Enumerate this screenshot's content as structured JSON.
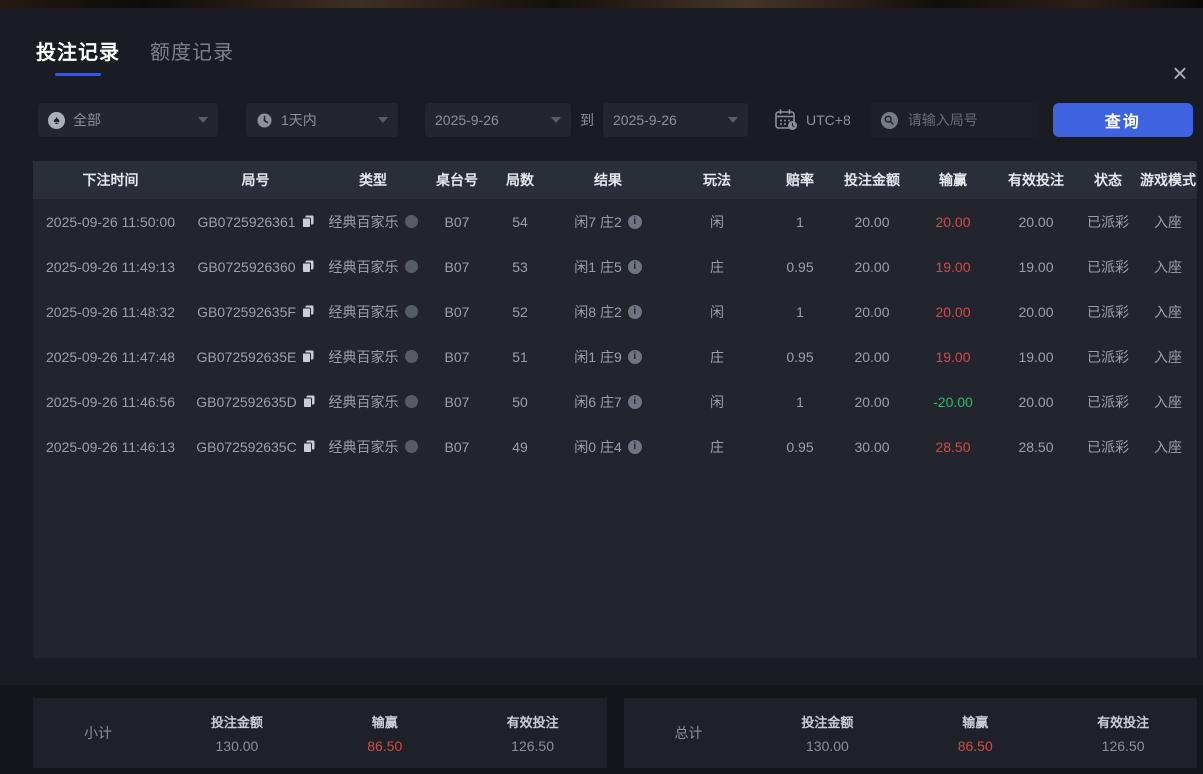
{
  "window": {
    "close_icon": "×"
  },
  "icons": {
    "spade": "♠"
  },
  "colors": {
    "accent_blue": "#3f63e0",
    "tab_underline": "#3557e8",
    "win_red": "#d24b43",
    "loss_green": "#21c06d"
  },
  "tabs": [
    {
      "label": "投注记录",
      "active": true
    },
    {
      "label": "额度记录",
      "active": false
    }
  ],
  "filters": {
    "game_type": {
      "value": "全部"
    },
    "time_range": {
      "value": "1天内"
    },
    "date_from": {
      "value": "2025-9-26"
    },
    "to_label": "到",
    "date_to": {
      "value": "2025-9-26"
    },
    "timezone": {
      "label": "UTC+8"
    },
    "round_search": {
      "placeholder": "请输入局号",
      "value": ""
    },
    "query_button": "查询"
  },
  "table": {
    "headers": [
      "下注时间",
      "局号",
      "类型",
      "桌台号",
      "局数",
      "结果",
      "玩法",
      "赔率",
      "投注金额",
      "输赢",
      "有效投注",
      "状态",
      "游戏模式"
    ],
    "rows": [
      {
        "time": "2025-09-26 11:50:00",
        "game_id": "GB0725926361",
        "type": "经典百家乐",
        "table_no": "B07",
        "rounds": "54",
        "result": "闲7 庄2",
        "play": "闲",
        "odds": "1",
        "bet_amount": "20.00",
        "win_loss": "20.00",
        "win_loss_type": "win",
        "valid_bet": "20.00",
        "status": "已派彩",
        "game_mode": "入座"
      },
      {
        "time": "2025-09-26 11:49:13",
        "game_id": "GB0725926360",
        "type": "经典百家乐",
        "table_no": "B07",
        "rounds": "53",
        "result": "闲1 庄5",
        "play": "庄",
        "odds": "0.95",
        "bet_amount": "20.00",
        "win_loss": "19.00",
        "win_loss_type": "win",
        "valid_bet": "19.00",
        "status": "已派彩",
        "game_mode": "入座"
      },
      {
        "time": "2025-09-26 11:48:32",
        "game_id": "GB072592635F",
        "type": "经典百家乐",
        "table_no": "B07",
        "rounds": "52",
        "result": "闲8 庄2",
        "play": "闲",
        "odds": "1",
        "bet_amount": "20.00",
        "win_loss": "20.00",
        "win_loss_type": "win",
        "valid_bet": "20.00",
        "status": "已派彩",
        "game_mode": "入座"
      },
      {
        "time": "2025-09-26 11:47:48",
        "game_id": "GB072592635E",
        "type": "经典百家乐",
        "table_no": "B07",
        "rounds": "51",
        "result": "闲1 庄9",
        "play": "庄",
        "odds": "0.95",
        "bet_amount": "20.00",
        "win_loss": "19.00",
        "win_loss_type": "win",
        "valid_bet": "19.00",
        "status": "已派彩",
        "game_mode": "入座"
      },
      {
        "time": "2025-09-26 11:46:56",
        "game_id": "GB072592635D",
        "type": "经典百家乐",
        "table_no": "B07",
        "rounds": "50",
        "result": "闲6 庄7",
        "play": "闲",
        "odds": "1",
        "bet_amount": "20.00",
        "win_loss": "-20.00",
        "win_loss_type": "loss",
        "valid_bet": "20.00",
        "status": "已派彩",
        "game_mode": "入座"
      },
      {
        "time": "2025-09-26 11:46:13",
        "game_id": "GB072592635C",
        "type": "经典百家乐",
        "table_no": "B07",
        "rounds": "49",
        "result": "闲0 庄4",
        "play": "庄",
        "odds": "0.95",
        "bet_amount": "30.00",
        "win_loss": "28.50",
        "win_loss_type": "win",
        "valid_bet": "28.50",
        "status": "已派彩",
        "game_mode": "入座"
      }
    ]
  },
  "summary": {
    "subtotal": {
      "label": "小计",
      "columns": [
        {
          "label": "投注金额",
          "value": "130.00",
          "highlight": false
        },
        {
          "label": "输赢",
          "value": "86.50",
          "highlight": true
        },
        {
          "label": "有效投注",
          "value": "126.50",
          "highlight": false
        }
      ]
    },
    "total": {
      "label": "总计",
      "columns": [
        {
          "label": "投注金额",
          "value": "130.00",
          "highlight": false
        },
        {
          "label": "输赢",
          "value": "86.50",
          "highlight": true
        },
        {
          "label": "有效投注",
          "value": "126.50",
          "highlight": false
        }
      ]
    }
  }
}
